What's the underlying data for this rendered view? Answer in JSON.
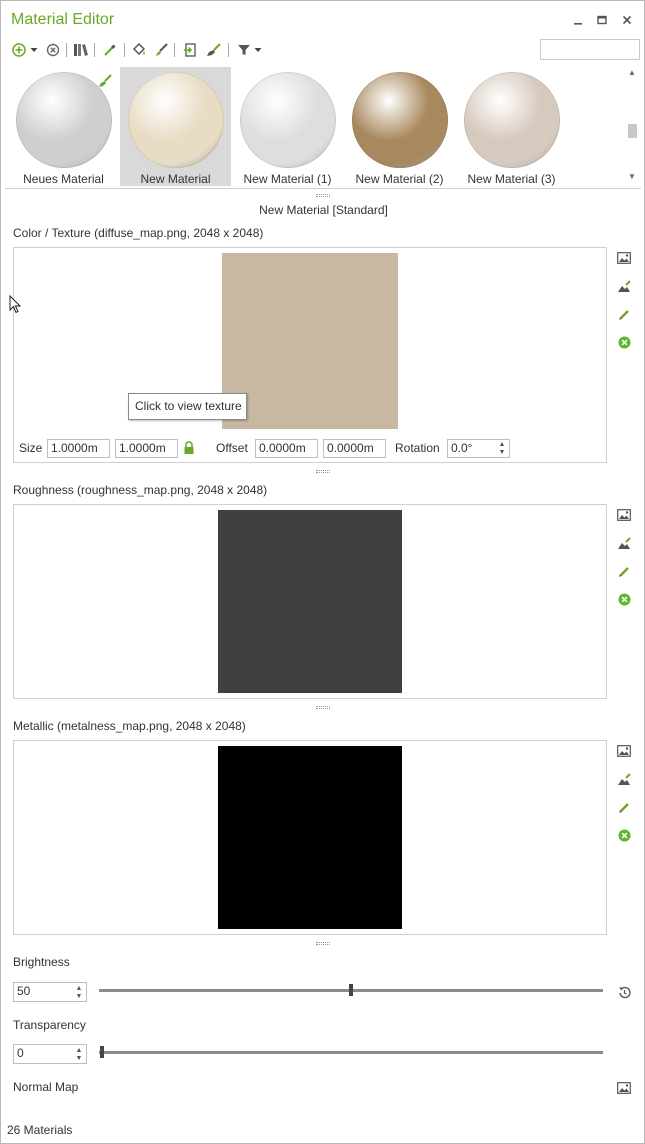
{
  "window": {
    "title": "Material Editor"
  },
  "search": {
    "placeholder": ""
  },
  "materials": [
    {
      "label": "Neues Material",
      "color": "#cfcfcf",
      "selected": false
    },
    {
      "label": "New Material",
      "color": "#e8dcc4",
      "selected": true
    },
    {
      "label": "New Material (1)",
      "color": "#dedede",
      "selected": false
    },
    {
      "label": "New Material (2)",
      "color": "#a8885e",
      "selected": false
    },
    {
      "label": "New Material (3)",
      "color": "#d6c9bd",
      "selected": false
    }
  ],
  "editor": {
    "header": "New Material [Standard]",
    "color_texture": {
      "label": "Color / Texture   (diffuse_map.png, 2048 x 2048)",
      "swatch": "#c8b8a2",
      "tooltip": "Click to view texture",
      "size_label": "Size",
      "size_w": "1.0000m",
      "size_h": "1.0000m",
      "offset_label": "Offset",
      "offset_x": "0.0000m",
      "offset_y": "0.0000m",
      "rotation_label": "Rotation",
      "rotation": "0.0°"
    },
    "roughness": {
      "label": "Roughness   (roughness_map.png, 2048 x 2048)",
      "swatch": "#404040"
    },
    "metallic": {
      "label": "Metallic   (metalness_map.png, 2048 x 2048)",
      "swatch": "#000000"
    },
    "brightness": {
      "label": "Brightness",
      "value": "50",
      "slider_fraction": 0.5
    },
    "transparency": {
      "label": "Transparency",
      "value": "0",
      "slider_fraction": 0.0
    },
    "normal_map": {
      "label": "Normal Map"
    }
  },
  "status": {
    "count": "26 Materials"
  },
  "colors": {
    "accent": "#6aa824",
    "remove": "#5cb82e"
  }
}
